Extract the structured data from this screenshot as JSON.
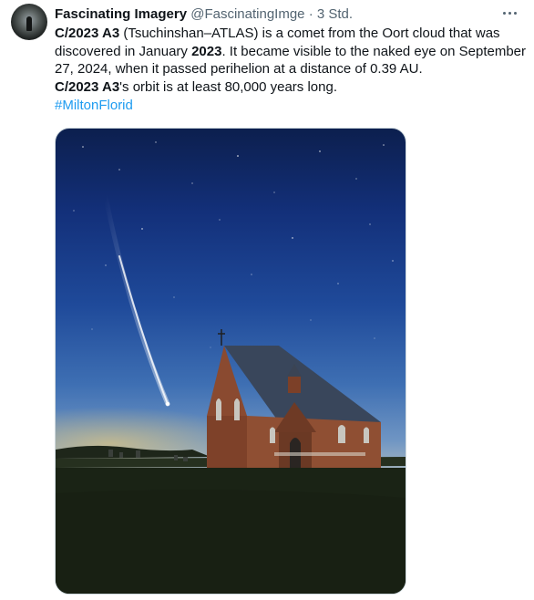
{
  "tweet": {
    "author_name": "Fascinating Imagery",
    "author_handle": "@FascinatingImge",
    "separator": "·",
    "timestamp": "3 Std.",
    "text_segments": {
      "s1_bold": "C/2023 A3",
      "s2": " (Tsuchinshan–ATLAS) is a comet from the Oort cloud that was discovered in January ",
      "s3_bold": "2023",
      "s4": ". It became visible to the naked eye on September 27, 2024, when it passed perihelion at a distance of 0.39 AU.",
      "s5_bold": "C/2023 A3",
      "s6": "'s orbit is at least 80,000 years long.",
      "hashtag": "#MiltonFlorid"
    }
  },
  "icons": {
    "more": "more-horizontal-icon",
    "avatar": "profile-avatar"
  },
  "colors": {
    "link": "#1d9bf0",
    "secondary_text": "#536471",
    "primary_text": "#0f1419"
  }
}
